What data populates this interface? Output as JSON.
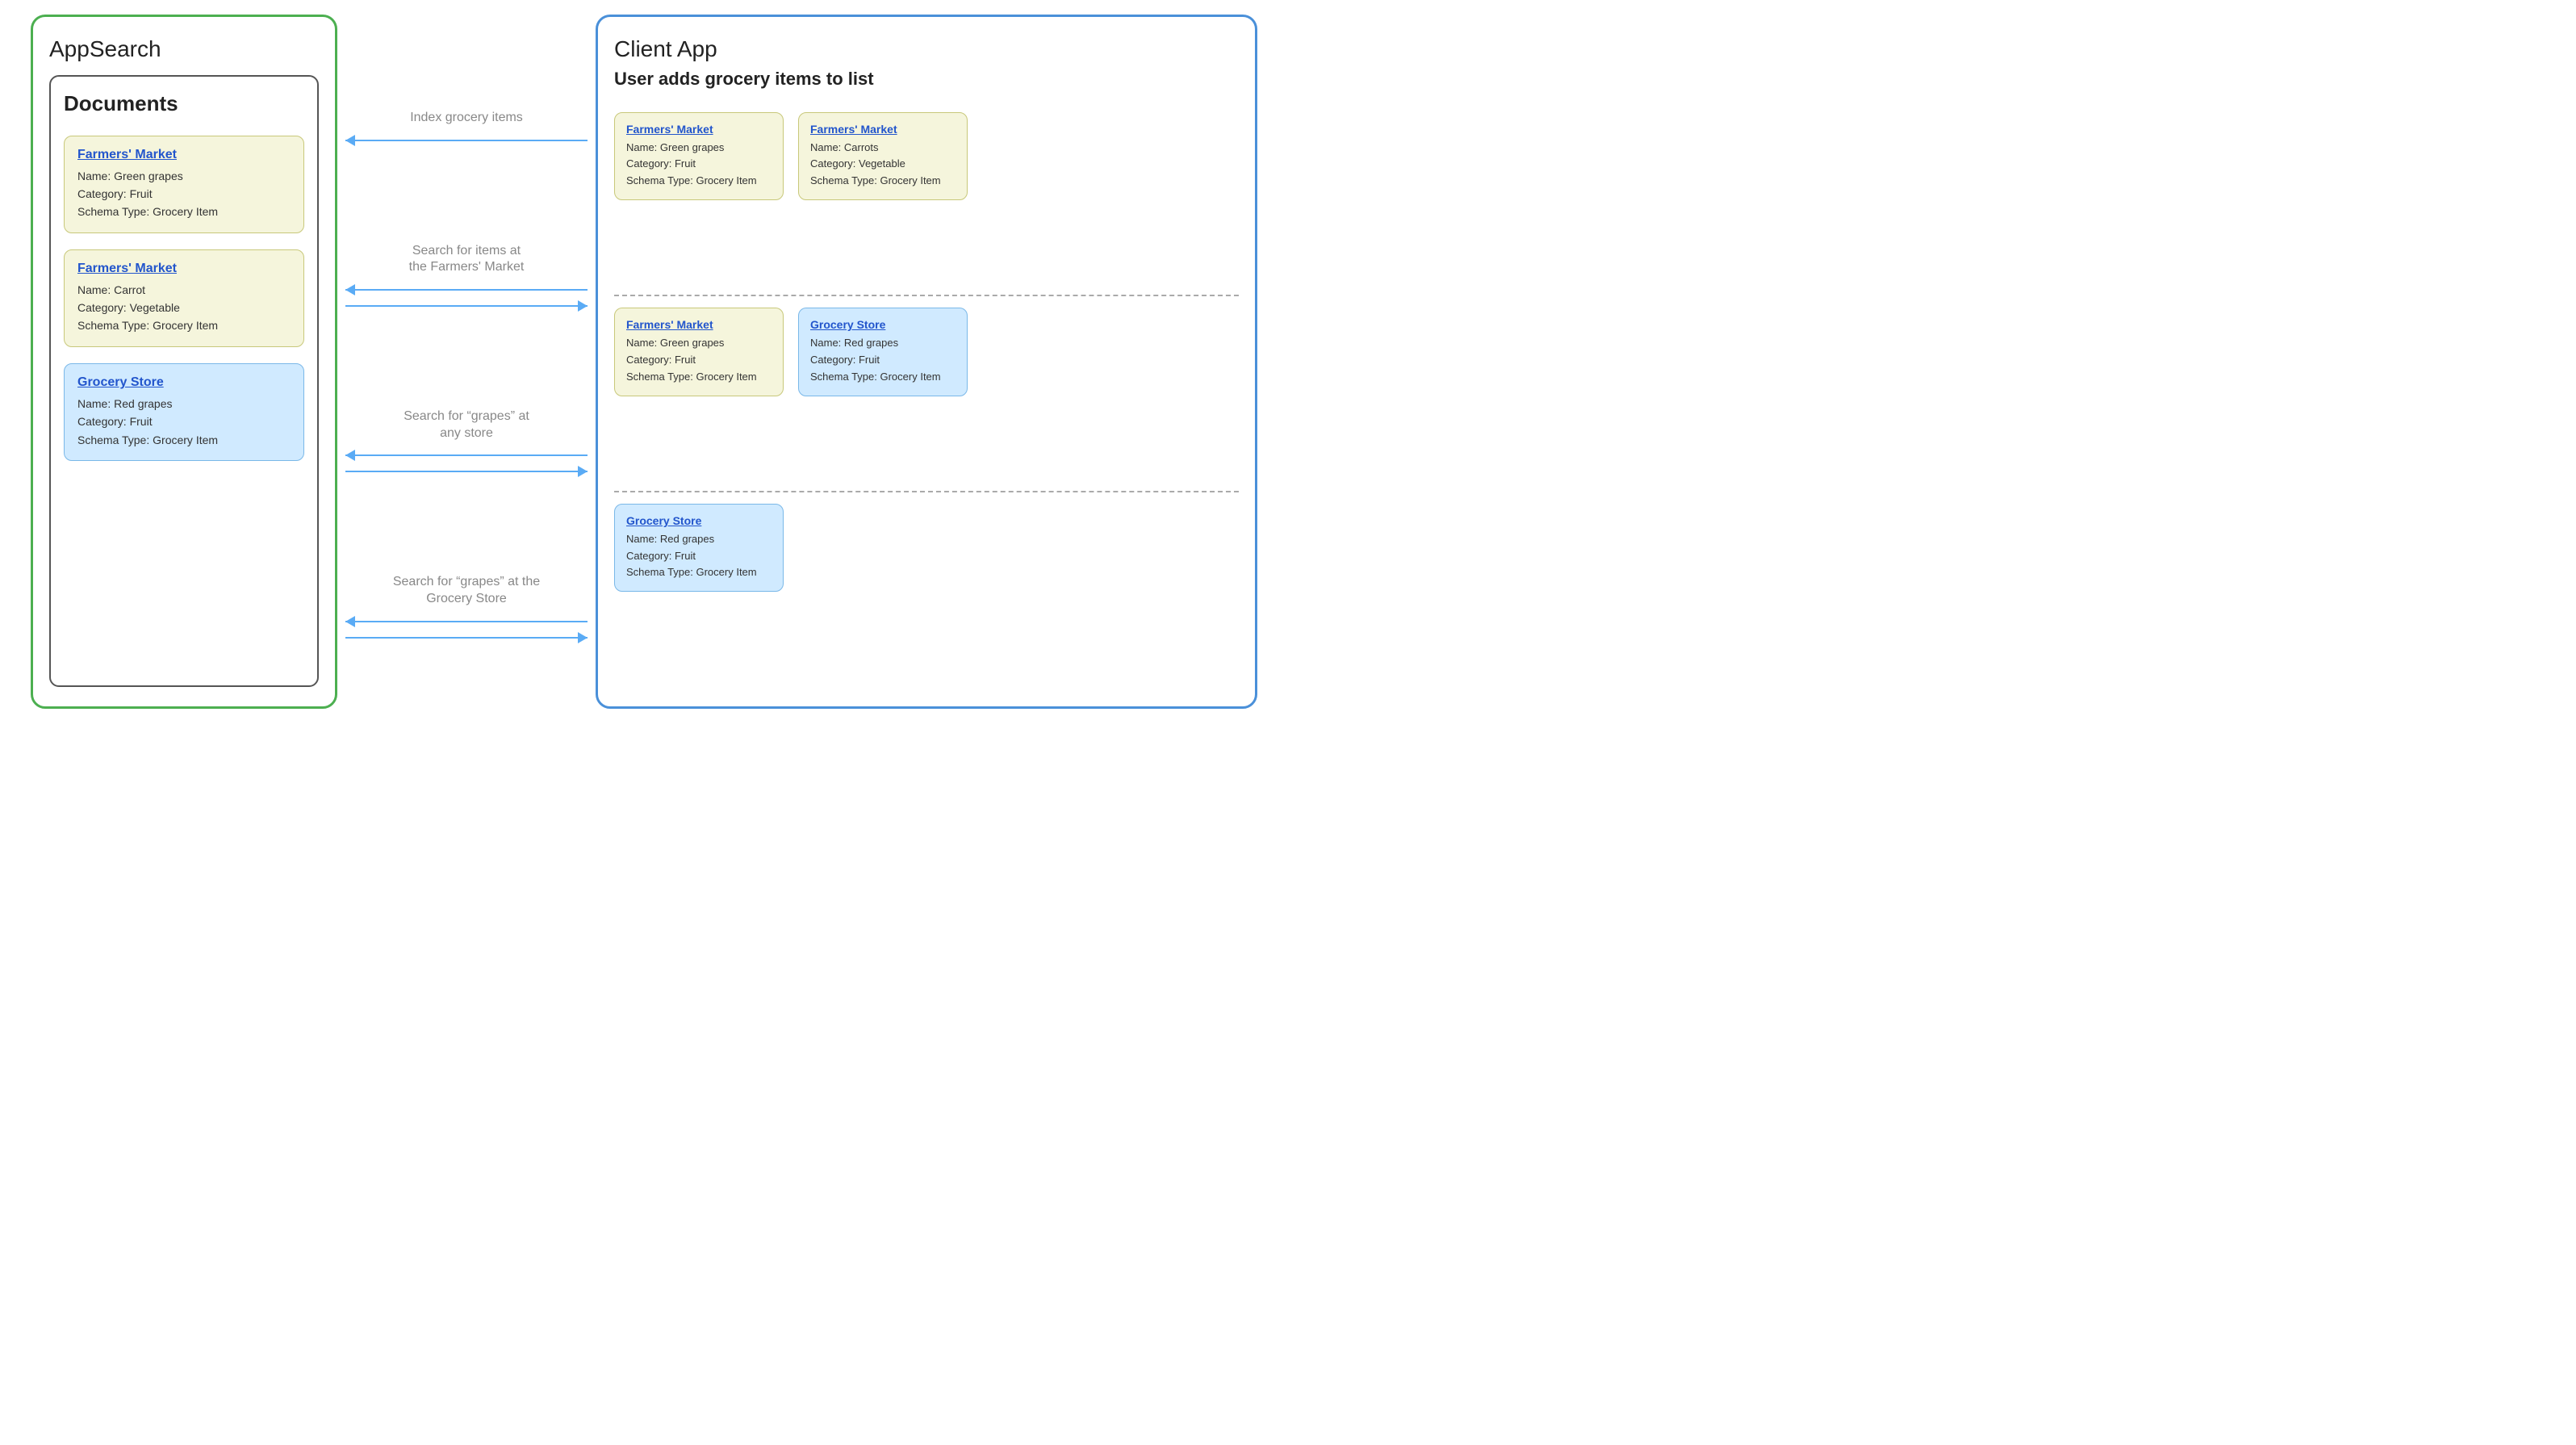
{
  "appsearch": {
    "title": "AppSearch",
    "documents_title": "Documents",
    "docs": [
      {
        "type": "yellow",
        "store": "Farmers' Market",
        "name": "Green grapes",
        "category": "Fruit",
        "schema_type": "Grocery Item"
      },
      {
        "type": "yellow",
        "store": "Farmers' Market",
        "name": "Carrot",
        "category": "Vegetable",
        "schema_type": "Grocery Item"
      },
      {
        "type": "blue",
        "store": "Grocery Store",
        "name": "Red grapes",
        "category": "Fruit",
        "schema_type": "Grocery Item"
      }
    ]
  },
  "arrows": [
    {
      "label": "Index grocery items",
      "has_left": true,
      "has_right": false
    },
    {
      "label": "Search for items at\nthe Farmers' Market",
      "has_left": true,
      "has_right": true
    },
    {
      "label": "Search for “grapes” at\nany store",
      "has_left": true,
      "has_right": true
    },
    {
      "label": "Search for “grapes” at the\nGrocery Store",
      "has_left": true,
      "has_right": true
    }
  ],
  "client": {
    "title": "Client App",
    "user_section_title": "User adds grocery items to list",
    "sections": [
      {
        "cards": [
          {
            "type": "yellow",
            "store": "Farmers' Market",
            "name": "Green grapes",
            "category": "Fruit",
            "schema_type": "Grocery Item"
          },
          {
            "type": "yellow",
            "store": "Farmers' Market",
            "name": "Carrots",
            "category": "Vegetable",
            "schema_type": "Grocery Item"
          }
        ]
      },
      {
        "cards": [
          {
            "type": "yellow",
            "store": "Farmers' Market",
            "name": "Green grapes",
            "category": "Fruit",
            "schema_type": "Grocery Item"
          },
          {
            "type": "blue",
            "store": "Grocery Store",
            "name": "Red grapes",
            "category": "Fruit",
            "schema_type": "Grocery Item"
          }
        ]
      },
      {
        "cards": [
          {
            "type": "blue",
            "store": "Grocery Store",
            "name": "Red grapes",
            "category": "Fruit",
            "schema_type": "Grocery Item"
          }
        ]
      }
    ]
  },
  "colors": {
    "green_border": "#4CAF50",
    "blue_border": "#4a90d9",
    "arrow_color": "#5aabf5",
    "yellow_bg": "#f5f5dc",
    "blue_bg": "#d0eaff"
  }
}
